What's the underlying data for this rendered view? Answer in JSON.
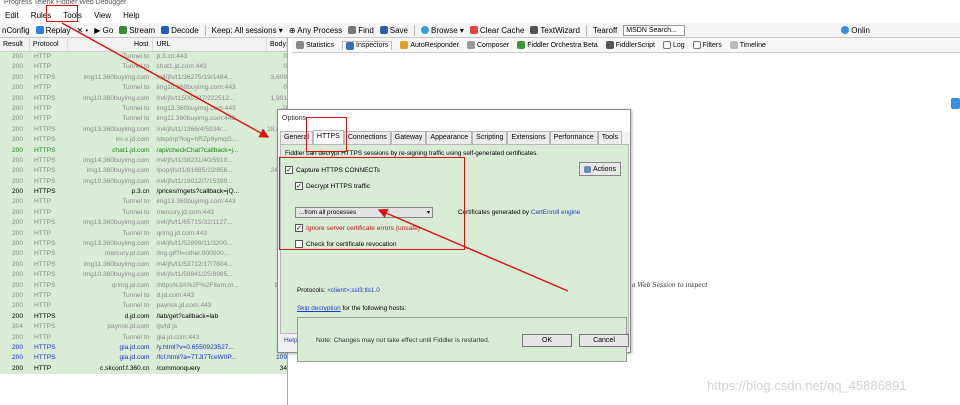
{
  "window": {
    "title": "Progress Telerik Fiddler Web Debugger"
  },
  "menu": [
    "Edit",
    "Rules",
    "Tools",
    "View",
    "Help"
  ],
  "toolbar": {
    "items": [
      "nConfig",
      "Replay",
      "✕ •",
      "▶ Go",
      "Stream",
      "Decode",
      "Keep: All sessions ▾",
      "⊕ Any Process",
      "Find",
      "Save",
      "Browse ▾",
      "Clear Cache",
      "TextWizard",
      "Tearoff"
    ],
    "search_placeholder": "MSDN Search...",
    "online": "Onlin"
  },
  "sessions": {
    "columns": [
      "Result",
      "Protocol",
      "Host",
      "URL",
      "Body"
    ],
    "rows": [
      {
        "result": "200",
        "protocol": "HTTP",
        "host": "Tunnel to",
        "url": "p.3.cn:443",
        "body": "0",
        "style": "gray"
      },
      {
        "result": "200",
        "protocol": "HTTP",
        "host": "Tunnel to",
        "url": "chat1.jd.com:443",
        "body": "0",
        "style": "gray"
      },
      {
        "result": "200",
        "protocol": "HTTPS",
        "host": "img11.360buyimg.com",
        "url": "/n4/jfs/t1/36275/19/1484...",
        "body": "3,609",
        "style": "gray"
      },
      {
        "result": "200",
        "protocol": "HTTP",
        "host": "Tunnel to",
        "url": "img10.360buyimg.com:443",
        "body": "0",
        "style": "gray"
      },
      {
        "result": "200",
        "protocol": "HTTPS",
        "host": "img10.360buyimg.com",
        "url": "/n4/jfs/t1500/337/222512...",
        "body": "1,991",
        "style": "gray"
      },
      {
        "result": "200",
        "protocol": "HTTP",
        "host": "Tunnel to",
        "url": "img13.360buyimg.com:443",
        "body": "0",
        "style": "gray"
      },
      {
        "result": "200",
        "protocol": "HTTP",
        "host": "Tunnel to",
        "url": "img11.360buyimg.com:443",
        "body": "0",
        "style": "gray"
      },
      {
        "result": "200",
        "protocol": "HTTPS",
        "host": "img13.360buyimg.com",
        "url": "/n4/jfs/t1/1366/4/5934/...",
        "body": "18,619",
        "style": "gray"
      },
      {
        "result": "200",
        "protocol": "HTTPS",
        "host": "im-x.jd.com",
        "url": "/dsp/np?log=hRZp9ymqG...",
        "body": "0",
        "style": "gray"
      },
      {
        "result": "200",
        "protocol": "HTTPS",
        "host": "chat1.jd.com",
        "url": "/api/checkChat?callback=j...",
        "body": "0",
        "style": "green"
      },
      {
        "result": "200",
        "protocol": "HTTPS",
        "host": "img14.360buyimg.com",
        "url": "/n4/jfs/t1/38231/40/5910...",
        "body": "5,0",
        "style": "gray"
      },
      {
        "result": "200",
        "protocol": "HTTPS",
        "host": "img1.360buyimg.com",
        "url": "/pop/jfs/t1/81685/22/856...",
        "body": "243,3",
        "style": "gray"
      },
      {
        "result": "200",
        "protocol": "HTTPS",
        "host": "img10.360buyimg.com",
        "url": "/n4/jfs/t1/19012/7/15399...",
        "body": "8,6",
        "style": "gray"
      },
      {
        "result": "200",
        "protocol": "HTTPS",
        "host": "p.3.cn",
        "url": "/prices/mgets?callback=jQ...",
        "body": "",
        "style": "black"
      },
      {
        "result": "200",
        "protocol": "HTTP",
        "host": "Tunnel to",
        "url": "img13.360buyimg.com:443",
        "body": "",
        "style": "gray"
      },
      {
        "result": "200",
        "protocol": "HTTP",
        "host": "Tunnel to",
        "url": "mercury.jd.com:443",
        "body": "",
        "style": "gray"
      },
      {
        "result": "200",
        "protocol": "HTTPS",
        "host": "img13.360buyimg.com",
        "url": "/n4/jfs/t1/65715/32/1127...",
        "body": "3,0",
        "style": "gray"
      },
      {
        "result": "200",
        "protocol": "HTTP",
        "host": "Tunnel to",
        "url": "qrimg.jd.com:443",
        "body": "",
        "style": "gray"
      },
      {
        "result": "200",
        "protocol": "HTTPS",
        "host": "img13.360buyimg.com",
        "url": "/n4/jfs/t1/52899/11/3200...",
        "body": "8,0",
        "style": "gray"
      },
      {
        "result": "200",
        "protocol": "HTTPS",
        "host": "mercury.jd.com",
        "url": "/log.gif?t=other.000000...",
        "body": "4",
        "style": "gray"
      },
      {
        "result": "200",
        "protocol": "HTTPS",
        "host": "img11.360buyimg.com",
        "url": "/n4/jfs/t1/53712/17/7804...",
        "body": "2,2",
        "style": "gray"
      },
      {
        "result": "200",
        "protocol": "HTTPS",
        "host": "img10.360buyimg.com",
        "url": "/n4/jfs/t1/59841/25/8985...",
        "body": "9,2",
        "style": "gray"
      },
      {
        "result": "200",
        "protocol": "HTTPS",
        "host": "qrimg.jd.com",
        "url": "/https%3A%2F%2Fitem.m...",
        "body": "18,5",
        "style": "gray"
      },
      {
        "result": "200",
        "protocol": "HTTP",
        "host": "Tunnel to",
        "url": "d.jd.com:443",
        "body": "",
        "style": "gray"
      },
      {
        "result": "200",
        "protocol": "HTTP",
        "host": "Tunnel to",
        "url": "payrisk.jd.com:443",
        "body": "",
        "style": "gray"
      },
      {
        "result": "200",
        "protocol": "HTTPS",
        "host": "d.jd.com",
        "url": "/lab/get?callback=lab",
        "body": "1",
        "style": "black"
      },
      {
        "result": "304",
        "protocol": "HTTPS",
        "host": "payrisk.jd.com",
        "url": "/js/td.js",
        "body": "",
        "style": "gray"
      },
      {
        "result": "200",
        "protocol": "HTTP",
        "host": "Tunnel to",
        "url": "gia.jd.com:443",
        "body": "",
        "style": "gray"
      },
      {
        "result": "200",
        "protocol": "HTTPS",
        "host": "gia.jd.com",
        "url": "/y.html?v=0.6550923527...",
        "body": "132",
        "style": "blue"
      },
      {
        "result": "200",
        "protocol": "HTTPS",
        "host": "gia.jd.com",
        "url": "/fcf.html?a=7TJI7TceW0P...",
        "body": "109",
        "style": "blue"
      },
      {
        "result": "200",
        "protocol": "HTTP",
        "host": "c.skconf.f.360.cn",
        "url": "/commonquery",
        "body": "34",
        "style": "black"
      }
    ]
  },
  "inspector_tabs": [
    "Statistics",
    "Inspectors",
    "AutoResponder",
    "Composer",
    "Fiddler Orchestra Beta",
    "FiddlerScript",
    "Log",
    "Filters",
    "Timeline"
  ],
  "inspector_tabs_active": "Inspectors",
  "inspector_hint": "a Web Session to inspect",
  "dialog": {
    "title": "Options",
    "tabs": [
      "General",
      "HTTPS",
      "Connections",
      "Gateway",
      "Appearance",
      "Scripting",
      "Extensions",
      "Performance",
      "Tools"
    ],
    "active_tab": "HTTPS",
    "description": "Fiddler can decrypt HTTPS sessions by re-signing traffic using self-generated certificates.",
    "actions_label": "Actions",
    "capture_label": "Capture HTTPS CONNECTs",
    "capture_checked": true,
    "decrypt_label": "Decrypt HTTPS traffic",
    "decrypt_checked": true,
    "process_value": "...from all processes",
    "cert_prefix": "Certificates generated by",
    "cert_link": "CertEnroll engine",
    "ignore_label": "Ignore server certificate errors (unsafe)",
    "ignore_checked": true,
    "revocation_label": "Check for certificate revocation",
    "revocation_checked": false,
    "protocols_prefix": "Protocols:",
    "protocols_value": "<client>;ssl3;tls1.0",
    "skip_link": "Skip decryption",
    "skip_suffix": "for the following hosts:",
    "help": "Help",
    "note": "Note: Changes may not take effect until Fiddler is restarted.",
    "ok": "OK",
    "cancel": "Cancel"
  },
  "watermark": "https://blog.csdn.net/qq_45886891",
  "colors": {
    "session_bg": "#d9ecd6",
    "annotation_red": "#e01010",
    "link_blue": "#1b3ec8"
  }
}
